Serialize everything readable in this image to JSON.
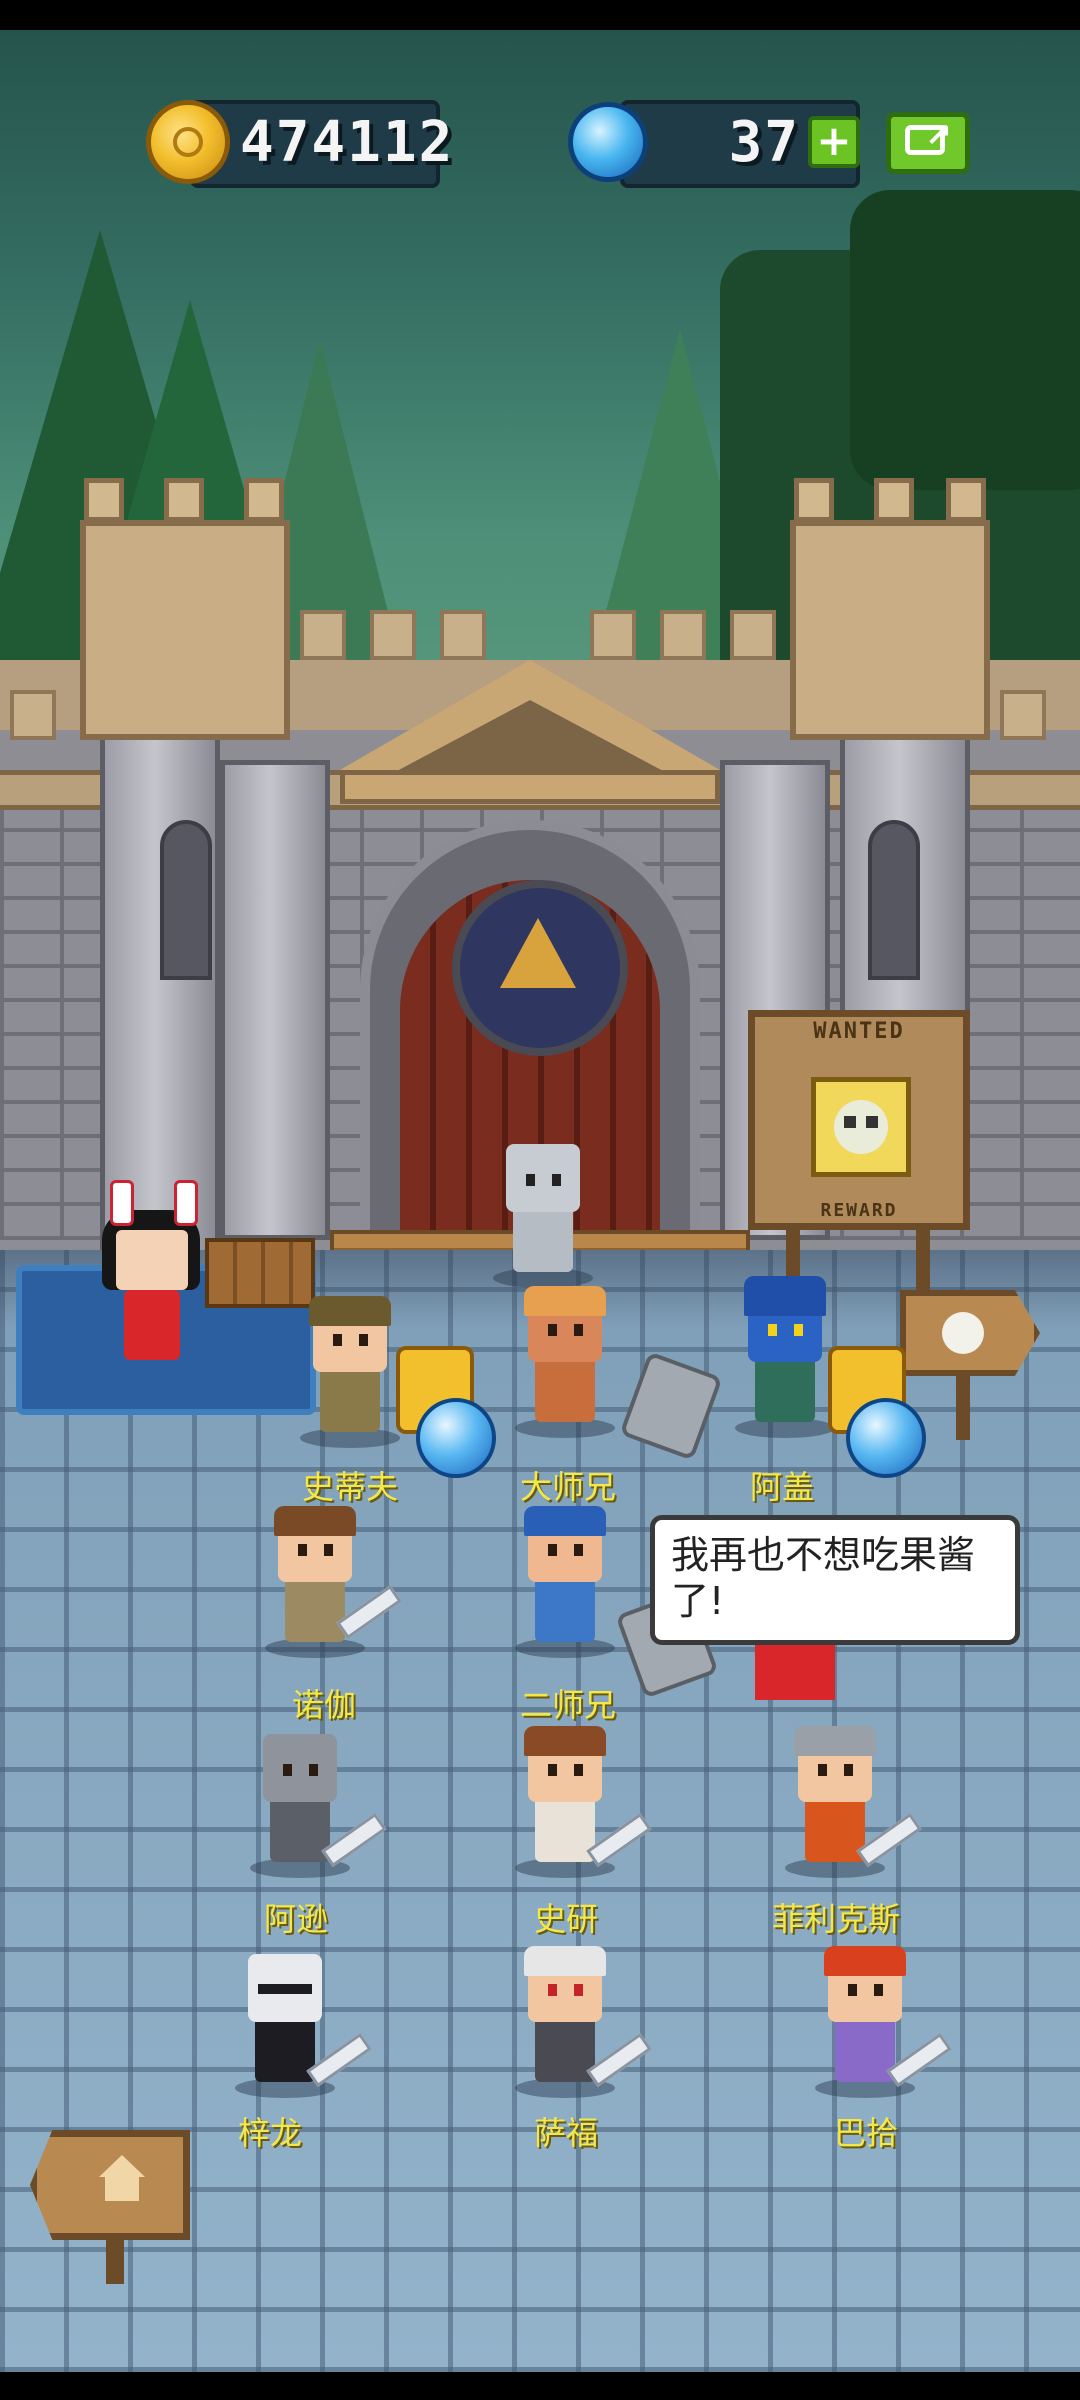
{
  "hud": {
    "gold": "474112",
    "gems": "37",
    "plus_icon": "plus-icon",
    "share_icon": "share-icon",
    "coin_icon": "coin-icon",
    "gem_icon": "gem-icon"
  },
  "wanted_board": {
    "title": "WANTED",
    "bottom_text": "REWARD"
  },
  "speech_bubble": {
    "text": "我再也不想吃果酱了!"
  },
  "heroes": [
    {
      "name": "史蒂夫"
    },
    {
      "name": "大师兄"
    },
    {
      "name": "阿盖"
    },
    {
      "name": "诺伽"
    },
    {
      "name": "二师兄"
    },
    {
      "name": "阿逊"
    },
    {
      "name": "史研"
    },
    {
      "name": "菲利克斯"
    },
    {
      "name": "梓龙"
    },
    {
      "name": "萨福"
    },
    {
      "name": "巴拾"
    }
  ],
  "colors": {
    "name_text": "#f2e84a",
    "gold_coin": "#f2be2c",
    "gem": "#49b6f0",
    "button_green": "#6cc424"
  }
}
